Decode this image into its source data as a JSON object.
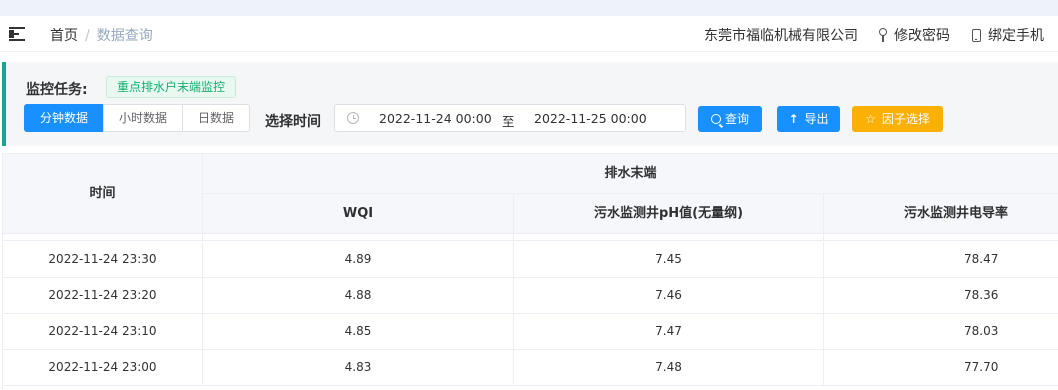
{
  "navbar": {
    "breadcrumb_home": "首页",
    "breadcrumb_sep": "/",
    "breadcrumb_current": "数据查询",
    "company": "东莞市福临机械有限公司",
    "change_password": "修改密码",
    "bind_phone": "绑定手机"
  },
  "filter": {
    "task_label": "监控任务:",
    "task_tag": "重点排水户末端监控",
    "tabs": [
      "分钟数据",
      "小时数据",
      "日数据"
    ],
    "time_label": "选择时间",
    "start_time": "2022-11-24 00:00",
    "range_sep": "至",
    "end_time": "2022-11-25 00:00",
    "query_button": "查询",
    "export_button": "导出",
    "factor_button": "因子选择"
  },
  "table": {
    "time_header": "时间",
    "group_header": "排水末端",
    "columns": [
      "WQI",
      "污水监测井pH值(无量纲)",
      "污水监测井电导率(mS/m)"
    ],
    "rows": [
      {
        "time": "2022-11-24 23:30",
        "wqi": "4.89",
        "ph": "7.45",
        "cond": "78.47"
      },
      {
        "time": "2022-11-24 23:20",
        "wqi": "4.88",
        "ph": "7.46",
        "cond": "78.36"
      },
      {
        "time": "2022-11-24 23:10",
        "wqi": "4.85",
        "ph": "7.47",
        "cond": "78.03"
      },
      {
        "time": "2022-11-24 23:00",
        "wqi": "4.83",
        "ph": "7.48",
        "cond": "77.70"
      }
    ]
  },
  "colors": {
    "primary": "#1890ff",
    "warning": "#fab005",
    "accent_bar": "#1aa295",
    "tag_text": "#13b073"
  }
}
